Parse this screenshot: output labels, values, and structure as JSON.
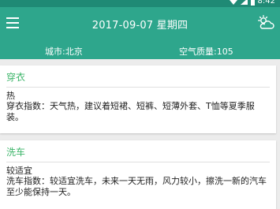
{
  "statusbar": {
    "time": "8:42"
  },
  "toolbar": {
    "date": "2017-09-07",
    "weekday": "星期四"
  },
  "info": {
    "city": "城市:北京",
    "air_quality": "空气质量:105"
  },
  "cards": [
    {
      "title": "穿衣",
      "level": "热",
      "description": "穿衣指数：天气热，建议着短裙、短裤、短薄外套、T恤等夏季服装。"
    },
    {
      "title": "洗车",
      "level": "较适宜",
      "description": "洗车指数：较适宜洗车，未来一天无雨，风力较小，擦洗一新的汽车至少能保持一天。"
    }
  ],
  "colors": {
    "statusbar": "#1f8a75",
    "toolbar": "#2ea68c",
    "card_title": "#3db56a",
    "background": "#ececec"
  },
  "icons": {
    "menu": "menu-icon",
    "weather": "partly-cloudy-icon",
    "wifi": "wifi-icon",
    "signal": "signal-icon",
    "battery": "battery-icon"
  }
}
